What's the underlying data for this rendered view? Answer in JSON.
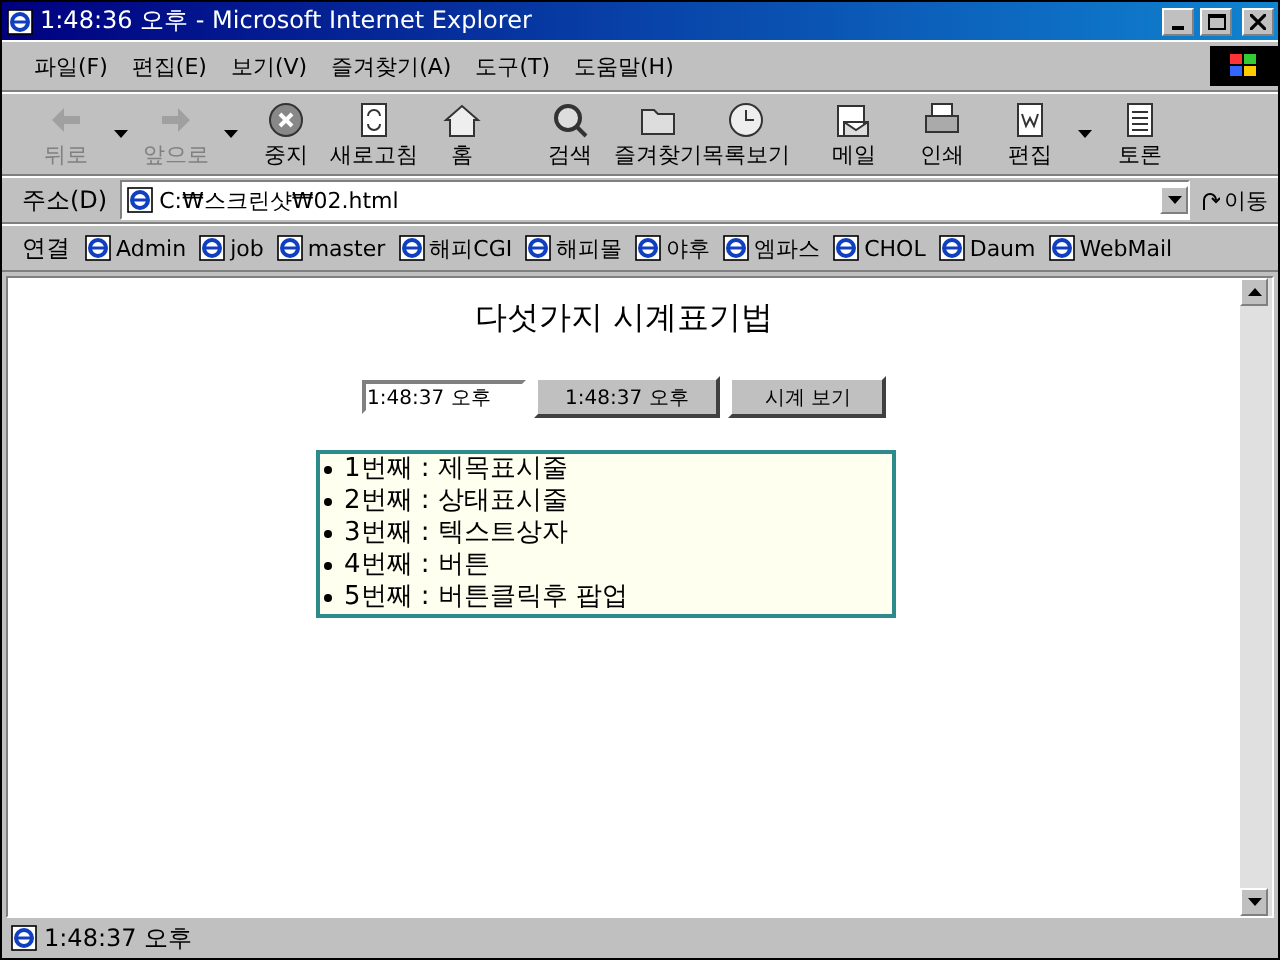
{
  "window": {
    "title": "1:48:36 오후 - Microsoft Internet Explorer"
  },
  "menu": [
    "파일(F)",
    "편집(E)",
    "보기(V)",
    "즐겨찾기(A)",
    "도구(T)",
    "도움말(H)"
  ],
  "toolbar": [
    {
      "kind": "back",
      "label": "뒤로",
      "disabled": true,
      "dropdown": true
    },
    {
      "kind": "forward",
      "label": "앞으로",
      "disabled": true,
      "dropdown": true
    },
    {
      "kind": "stop",
      "label": "중지",
      "disabled": false,
      "dropdown": false
    },
    {
      "kind": "refresh",
      "label": "새로고침",
      "disabled": false,
      "dropdown": false
    },
    {
      "kind": "home",
      "label": "홈",
      "disabled": false,
      "dropdown": false
    },
    {
      "kind": "search",
      "label": "검색",
      "disabled": false,
      "dropdown": false
    },
    {
      "kind": "favorites",
      "label": "즐겨찾기",
      "disabled": false,
      "dropdown": false
    },
    {
      "kind": "history",
      "label": "목록보기",
      "disabled": false,
      "dropdown": false
    },
    {
      "kind": "mail",
      "label": "메일",
      "disabled": false,
      "dropdown": false
    },
    {
      "kind": "print",
      "label": "인쇄",
      "disabled": false,
      "dropdown": false
    },
    {
      "kind": "edit",
      "label": "편집",
      "disabled": false,
      "dropdown": true
    },
    {
      "kind": "discuss",
      "label": "토론",
      "disabled": false,
      "dropdown": false
    }
  ],
  "address": {
    "label": "주소(D)",
    "value": "C:₩스크린샷₩02.html",
    "go": "이동"
  },
  "links": {
    "label": "연결",
    "items": [
      "Admin",
      "job",
      "master",
      "해피CGI",
      "해피몰",
      "야후",
      "엠파스",
      "CHOL",
      "Daum",
      "WebMail"
    ]
  },
  "page": {
    "heading": "다섯가지 시계표기법",
    "clock_field": "1:48:37 오후",
    "clock_button": "1:48:37 오후",
    "show_button": "시계 보기",
    "list": [
      "1번째 : 제목표시줄",
      "2번째 : 상태표시줄",
      "3번째 : 텍스트상자",
      "4번째 : 버튼",
      "5번째 : 버튼클릭후 팝업"
    ]
  },
  "status_bar": {
    "text": "1:48:37 오후"
  }
}
